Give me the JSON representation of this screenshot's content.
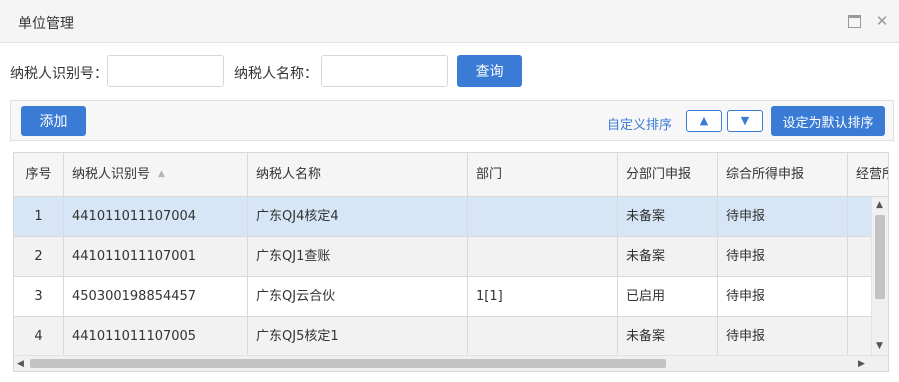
{
  "window": {
    "title": "单位管理",
    "icons": [
      "maximize-icon",
      "close-icon"
    ],
    "close_glyph": "✕"
  },
  "search": {
    "taxpayer_id_label": "纳税人识别号：",
    "taxpayer_id_value": "",
    "taxpayer_name_label": "纳税人名称：",
    "taxpayer_name_value": "",
    "query_button": "查询"
  },
  "toolbar": {
    "add_button": "添加",
    "custom_sort_link": "自定义排序",
    "move_up_glyph": "▲",
    "move_down_glyph": "▼",
    "set_default_sort_button": "设定为默认排序"
  },
  "grid": {
    "sort_indicator": "▲",
    "columns": [
      "序号",
      "纳税人识别号",
      "纳税人名称",
      "部门",
      "分部门申报",
      "综合所得申报",
      "经营所"
    ],
    "rows": [
      [
        "1",
        "441011011107004",
        "广东QJ4核定4",
        "",
        "未备案",
        "待申报",
        ""
      ],
      [
        "2",
        "441011011107001",
        "广东QJ1查账",
        "",
        "未备案",
        "待申报",
        ""
      ],
      [
        "3",
        "450300198854457",
        "广东QJ云合伙",
        "1[1]",
        "已启用",
        "待申报",
        ""
      ],
      [
        "4",
        "441011011107005",
        "广东QJ5核定1",
        "",
        "未备案",
        "待申报",
        ""
      ]
    ],
    "selected_row": 1
  },
  "scrollbars": {
    "up_glyph": "▲",
    "down_glyph": "▼",
    "left_glyph": "◀",
    "right_glyph": "▶"
  },
  "colors": {
    "accent": "#3a7bd5",
    "selected_row": "#d6e6f6",
    "header_bg": "#f5f5f5"
  }
}
